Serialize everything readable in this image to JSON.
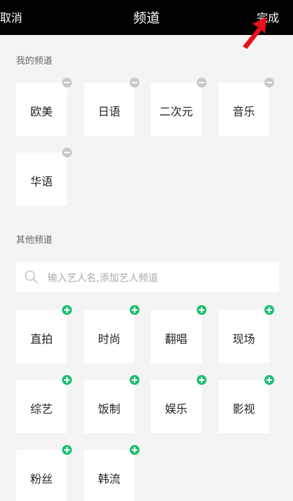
{
  "header": {
    "cancel_label": "取消",
    "title": "频道",
    "done_label": "完成"
  },
  "my_channels": {
    "label": "我的频道",
    "items": [
      "欧美",
      "日语",
      "二次元",
      "音乐",
      "华语"
    ]
  },
  "other_channels": {
    "label": "其他频道",
    "search_placeholder": "输入艺人名,添加艺人频道",
    "items": [
      "直拍",
      "时尚",
      "翻唱",
      "现场",
      "综艺",
      "饭制",
      "娱乐",
      "影视",
      "粉丝",
      "韩流"
    ]
  },
  "colors": {
    "header_bg": "#000000",
    "add_badge": "#1ebe74",
    "remove_badge": "#c9c9c9",
    "annotation_arrow": "#e8101a"
  }
}
